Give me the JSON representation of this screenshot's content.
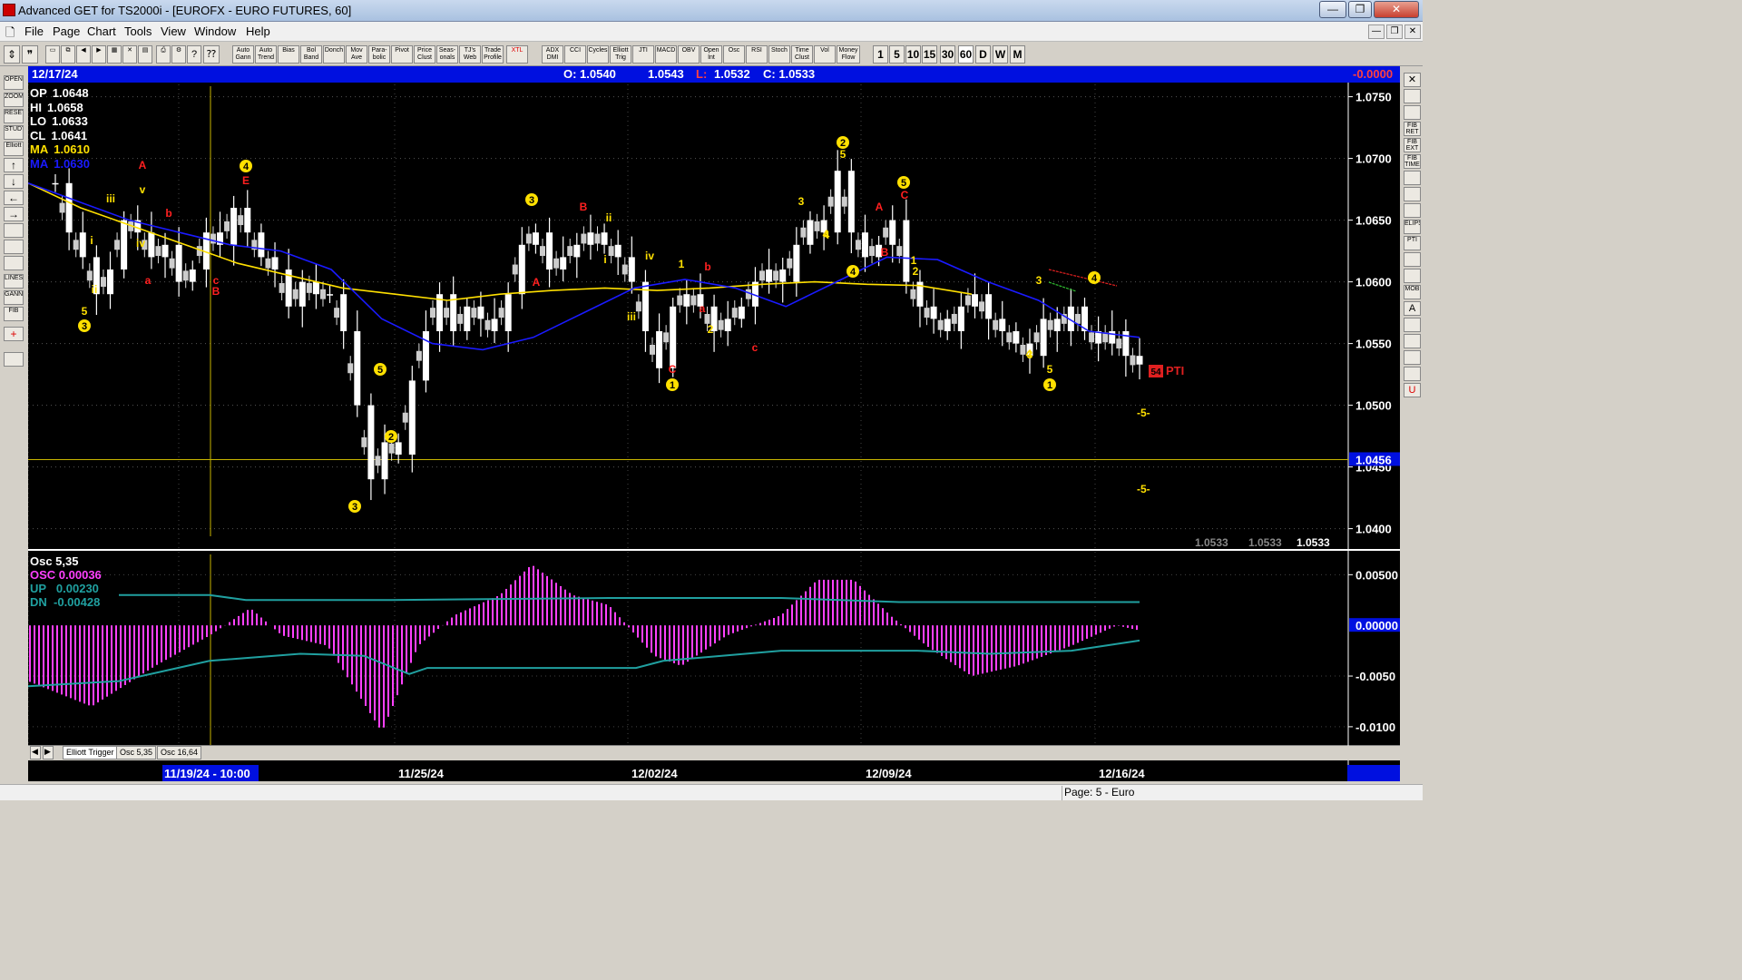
{
  "window": {
    "title": "Advanced GET for TS2000i - [EUROFX - EURO FUTURES, 60]",
    "min": "—",
    "max": "❐",
    "close": "✕"
  },
  "menu": [
    "File",
    "Page",
    "Chart",
    "Tools",
    "View",
    "Window",
    "Help"
  ],
  "toolbar": {
    "buttons": [
      "Auto Gann",
      "Auto Trend",
      "Bias",
      "Bol Band",
      "Donch",
      "Mov Ave",
      "Para- bolic",
      "Pivot",
      "Price Clust",
      "Seas- onals",
      "TJ's Web",
      "Trade Profile",
      "XTL",
      "ADX DMI",
      "CCI",
      "Cycles",
      "Elliott Trig",
      "JTI",
      "MACD",
      "OBV",
      "Open Int",
      "Osc",
      "RSI",
      "Stoch",
      "Time Clust",
      "Vol",
      "Money Flow"
    ],
    "periods": [
      "1",
      "5",
      "10",
      "15",
      "30",
      "60",
      "D",
      "W",
      "M"
    ]
  },
  "left_tools": [
    "OPEN",
    "ZOOM",
    "RESET",
    "STUDY",
    "Elliott",
    "↑",
    "↓",
    "←",
    "→",
    "",
    "",
    "",
    "LINES",
    "GANN",
    "FIB",
    "+",
    ""
  ],
  "right_tools": [
    "✕",
    "",
    "",
    "FIB RET",
    "FIB EXT",
    "FIB TIME",
    "",
    "",
    "",
    "ELIPS",
    "PTI",
    "",
    "",
    "MOB",
    "A",
    "",
    "",
    "",
    "",
    "U"
  ],
  "infobar": {
    "date": "12/17/24",
    "open": "O: 1.0540",
    "high": "1.0543",
    "low_label": "L:",
    "low": "1.0532",
    "close": "C: 1.0533",
    "change": "-0.0000"
  },
  "legend": [
    {
      "label": "OP",
      "value": "1.0648",
      "color": "#ffffff"
    },
    {
      "label": "HI",
      "value": "1.0658",
      "color": "#ffffff"
    },
    {
      "label": "LO",
      "value": "1.0633",
      "color": "#ffffff"
    },
    {
      "label": "CL",
      "value": "1.0641",
      "color": "#ffffff"
    },
    {
      "label": "MA",
      "value": "1.0610",
      "color": "#ffe000"
    },
    {
      "label": "MA",
      "value": "1.0630",
      "color": "#1a1aff"
    }
  ],
  "price_axis": {
    "labels": [
      "1.0750",
      "1.0700",
      "1.0650",
      "1.0600",
      "1.0550",
      "1.0500",
      "1.0450",
      "1.0400"
    ],
    "highlight": "1.0456"
  },
  "bottom_values": [
    "1.0533",
    "1.0533",
    "1.0533"
  ],
  "osc_legend": {
    "title": "Osc 5,35",
    "osc": "OSC 0.00036",
    "up_label": "UP",
    "up": "0.00230",
    "dn_label": "DN",
    "dn": "-0.00428"
  },
  "osc_axis": {
    "labels": [
      "0.00500",
      "-0.0050",
      "-0.0100"
    ],
    "highlight": "0.00000"
  },
  "tabs": [
    "Elliott Trigger",
    "Osc 5,35",
    "Osc 16,64"
  ],
  "dates": [
    "11/19/24 - 10:00",
    "11/25/24",
    "12/02/24",
    "12/09/24",
    "12/16/24"
  ],
  "pti": {
    "number": "54",
    "label": "PTI"
  },
  "target_marks": [
    "-5-",
    "-5-"
  ],
  "wave_labels": {
    "yellow_circled": [
      "3",
      "4",
      "3",
      "1",
      "2",
      "5",
      "4",
      "1",
      "5",
      "2",
      "3",
      "4"
    ],
    "yellow": [
      "i",
      "ii",
      "iii",
      "iv",
      "v",
      "5",
      "i",
      "ii",
      "iii",
      "iv",
      "1",
      "2",
      "3",
      "4",
      "3",
      "4",
      "5",
      "1",
      "2",
      "5",
      "3",
      "4"
    ],
    "red": [
      "A",
      "b",
      "a",
      "c",
      "B",
      "B",
      "A",
      "C",
      "a",
      "b",
      "c",
      "A",
      "B",
      "C",
      "E"
    ]
  },
  "status": {
    "page": "Page: 5 - Euro"
  },
  "colors": {
    "candle": "#ffffff",
    "ma_fast": "#ffe000",
    "ma_slow": "#1a1aff",
    "osc": "#ff40ff",
    "bands": "#20a0a0",
    "info_bg": "#0010e0"
  },
  "chart_data": {
    "type": "candlestick",
    "x": [
      "11/19/24",
      "11/25/24",
      "12/02/24",
      "12/09/24",
      "12/16/24",
      "12/17/24"
    ],
    "last_bar": {
      "open": 1.054,
      "high": 1.0543,
      "low": 1.0532,
      "close": 1.0533
    },
    "ylim": [
      1.0385,
      1.076
    ],
    "close_path": [
      1.068,
      1.064,
      1.062,
      1.059,
      1.061,
      1.065,
      1.064,
      1.062,
      1.063,
      1.06,
      1.061,
      1.064,
      1.063,
      1.066,
      1.064,
      1.062,
      1.061,
      1.058,
      1.06,
      1.059,
      1.059,
      1.056,
      1.05,
      1.044,
      1.047,
      1.046,
      1.052,
      1.056,
      1.059,
      1.056,
      1.058,
      1.057,
      1.056,
      1.059,
      1.063,
      1.064,
      1.061,
      1.062,
      1.063,
      1.064,
      1.063,
      1.062,
      1.06,
      1.056,
      1.053,
      1.058,
      1.059,
      1.058,
      1.056,
      1.057,
      1.058,
      1.06,
      1.061,
      1.06,
      1.063,
      1.065,
      1.064,
      1.069,
      1.064,
      1.062,
      1.063,
      1.065,
      1.06,
      1.058,
      1.057,
      1.056,
      1.058,
      1.059,
      1.057,
      1.056,
      1.055,
      1.054,
      1.057,
      1.056,
      1.058,
      1.056,
      1.055,
      1.056,
      1.054,
      1.0533
    ],
    "ma_fast": [
      1.068,
      1.066,
      1.0645,
      1.063,
      1.0615,
      1.0605,
      1.0595,
      1.059,
      1.0585,
      1.059,
      1.0593,
      1.0595,
      1.0593,
      1.0595,
      1.0598,
      1.06,
      1.0598,
      1.0597,
      1.059
    ],
    "ma_slow": [
      1.068,
      1.0665,
      1.065,
      1.064,
      1.063,
      1.0625,
      1.061,
      1.057,
      1.055,
      1.0545,
      1.0555,
      1.0575,
      1.0595,
      1.0602,
      1.0595,
      1.058,
      1.06,
      1.062,
      1.0618,
      1.06,
      1.0585,
      1.056,
      1.0555
    ],
    "osc_axis_lim": [
      -0.0118,
      0.007
    ]
  }
}
